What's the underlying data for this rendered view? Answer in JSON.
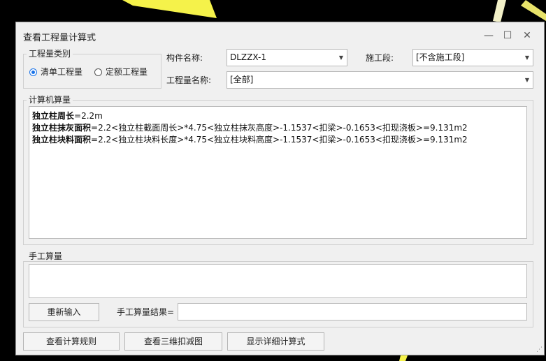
{
  "window": {
    "title": "查看工程量计算式",
    "minimize": "—",
    "maximize": "☐",
    "close": "✕"
  },
  "quantity_type": {
    "legend": "工程量类别",
    "options": [
      {
        "label": "清单工程量",
        "selected": true
      },
      {
        "label": "定额工程量",
        "selected": false
      }
    ]
  },
  "component": {
    "label": "构件名称:",
    "value": "DLZZX-1"
  },
  "stage": {
    "label": "施工段:",
    "value": "[不含施工段]"
  },
  "quantity_name": {
    "label": "工程量名称:",
    "value": "[全部]"
  },
  "computer_calc": {
    "legend": "计算机算量",
    "lines": [
      {
        "name": "独立柱周长",
        "expr": "=2.2m"
      },
      {
        "name": "独立柱抹灰面积",
        "expr": "=2.2<独立柱截面周长>*4.75<独立柱抹灰高度>-1.1537<扣梁>-0.1653<扣现浇板>=9.131m2"
      },
      {
        "name": "独立柱块料面积",
        "expr": "=2.2<独立柱块料长度>*4.75<独立柱块料高度>-1.1537<扣梁>-0.1653<扣现浇板>=9.131m2"
      }
    ]
  },
  "manual_calc": {
    "legend": "手工算量",
    "reinput_label": "重新输入",
    "result_label": "手工算量结果=",
    "result_value": ""
  },
  "footer": {
    "rules_label": "查看计算规则",
    "view3d_label": "查看三维扣减图",
    "detail_label": "显示详细计算式"
  },
  "colors": {
    "accent": "#1a73e8",
    "background_stripe": "#f5f24a"
  }
}
